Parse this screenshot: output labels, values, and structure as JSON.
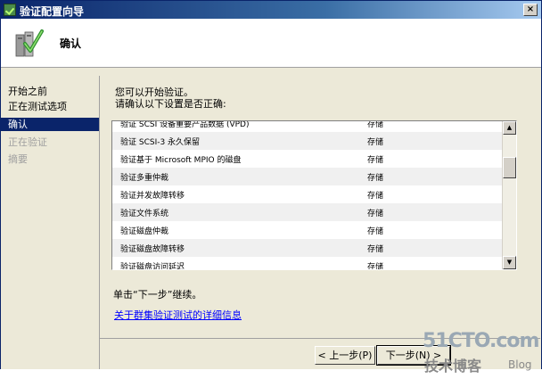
{
  "window": {
    "title": "验证配置向导",
    "close_label": "×"
  },
  "header": {
    "title": "确认",
    "icon": "validation-wizard-icon"
  },
  "nav": {
    "items": [
      {
        "label": "开始之前",
        "state": "normal"
      },
      {
        "label": "正在测试选项",
        "state": "normal"
      },
      {
        "label": "确认",
        "state": "selected"
      },
      {
        "label": "正在验证",
        "state": "disabled"
      },
      {
        "label": "摘要",
        "state": "disabled"
      }
    ]
  },
  "content": {
    "line1": "您可以开始验证。",
    "line2": "请确认以下设置是否正确:",
    "rows": [
      {
        "name": "验证 SCSI 设备重要产品数据 (VPD)",
        "status": "存储"
      },
      {
        "name": "验证 SCSI-3 永久保留",
        "status": "存储"
      },
      {
        "name": "验证基于 Microsoft MPIO 的磁盘",
        "status": "存储"
      },
      {
        "name": "验证多重仲裁",
        "status": "存储"
      },
      {
        "name": "验证并发故障转移",
        "status": "存储"
      },
      {
        "name": "验证文件系统",
        "status": "存储"
      },
      {
        "name": "验证磁盘仲裁",
        "status": "存储"
      },
      {
        "name": "验证磁盘故障转移",
        "status": "存储"
      },
      {
        "name": "验证磁盘访问延迟",
        "status": "存储"
      }
    ],
    "hint": "单击“下一步”继续。",
    "link": "关于群集验证测试的详细信息"
  },
  "buttons": {
    "prev": "< 上一步(P)",
    "next": "下一步(N) >"
  },
  "watermark": {
    "site": "51CTO.com",
    "sub": "技术博客",
    "blog": "Blog"
  }
}
